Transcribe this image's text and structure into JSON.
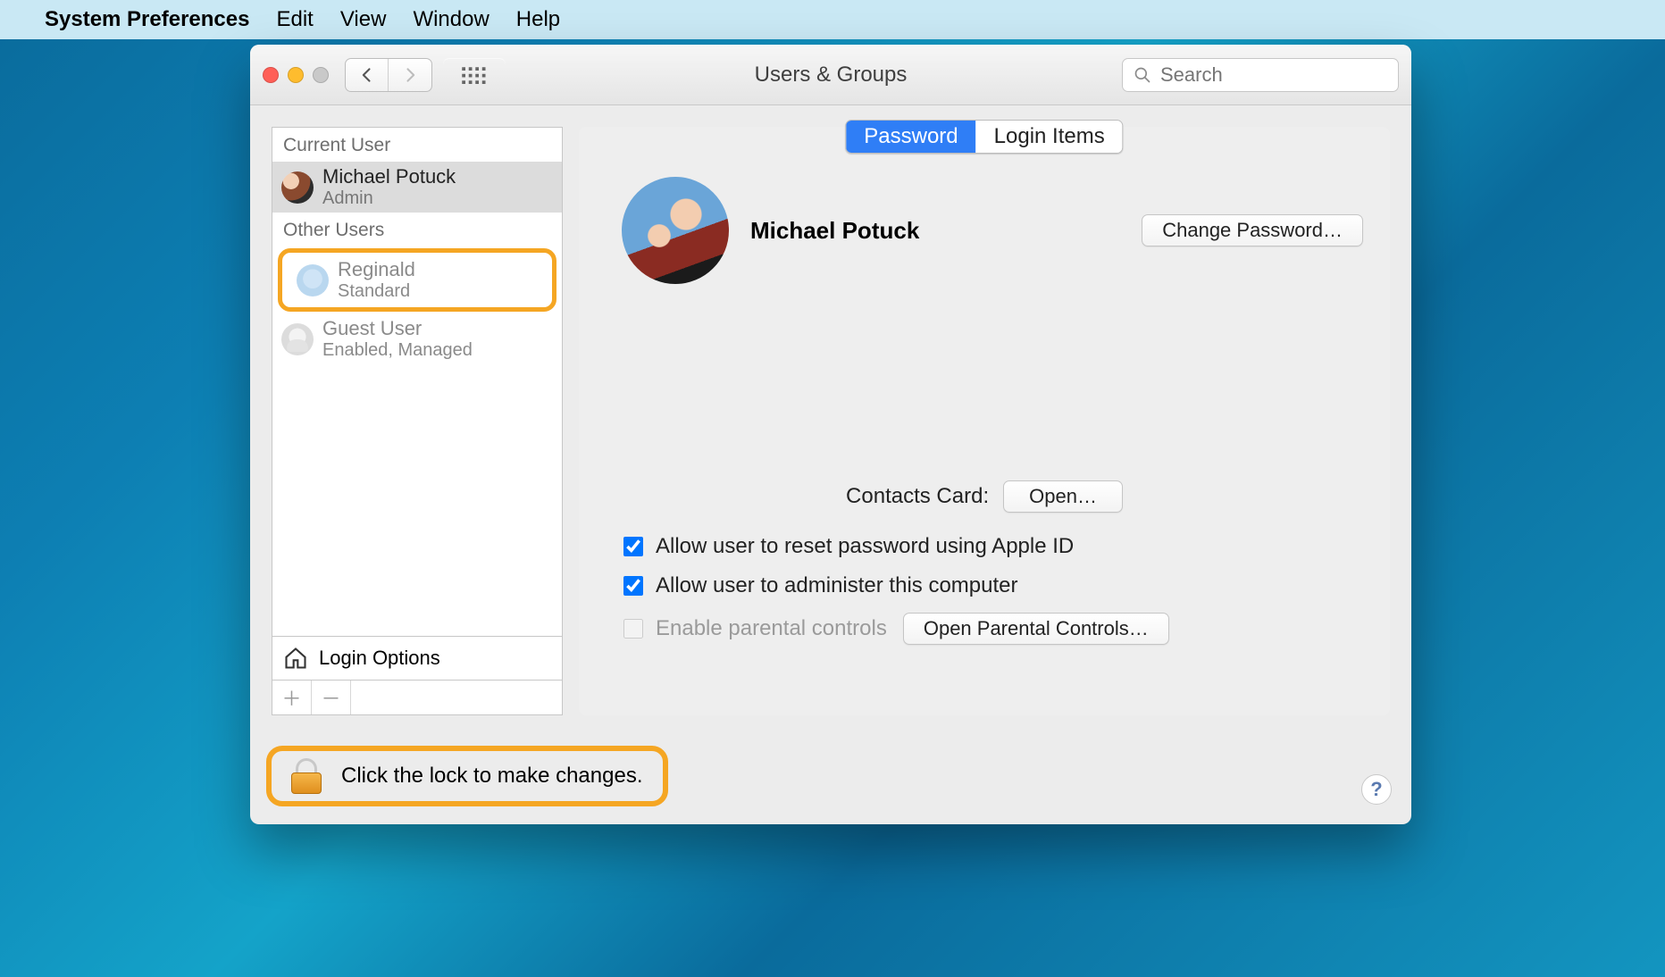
{
  "menubar": {
    "app": "System Preferences",
    "items": [
      "Edit",
      "View",
      "Window",
      "Help"
    ]
  },
  "window": {
    "title": "Users & Groups",
    "search_placeholder": "Search"
  },
  "sidebar": {
    "current_header": "Current User",
    "other_header": "Other Users",
    "current_user": {
      "name": "Michael Potuck",
      "role": "Admin"
    },
    "others": [
      {
        "name": "Reginald",
        "role": "Standard"
      },
      {
        "name": "Guest User",
        "role": "Enabled, Managed"
      }
    ],
    "login_options": "Login Options"
  },
  "main": {
    "tabs": {
      "password": "Password",
      "login_items": "Login Items"
    },
    "user_name": "Michael Potuck",
    "change_password": "Change Password…",
    "contacts_label": "Contacts Card:",
    "open": "Open…",
    "check_reset": "Allow user to reset password using Apple ID",
    "check_admin": "Allow user to administer this computer",
    "check_parental": "Enable parental controls",
    "open_parental": "Open Parental Controls…"
  },
  "lock": {
    "text": "Click the lock to make changes."
  }
}
